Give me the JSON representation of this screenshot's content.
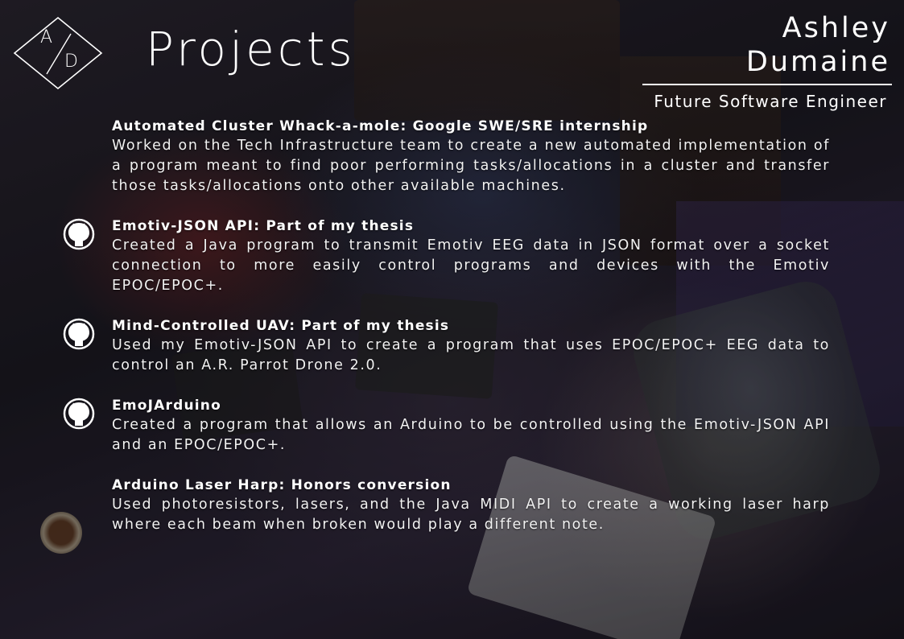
{
  "header": {
    "title": "Projects",
    "monogram": {
      "first": "A",
      "second": "D"
    },
    "name": "Ashley Dumaine",
    "role": "Future Software Engineer"
  },
  "projects": [
    {
      "title": "Automated Cluster Whack-a-mole: Google SWE/SRE internship",
      "description": "Worked on the Tech Infrastructure team to create a new automated implementation of a program meant to find poor performing tasks/allocations in a cluster and transfer those tasks/allocations onto other available machines.",
      "icon": "none"
    },
    {
      "title": "Emotiv-JSON API: Part of my thesis",
      "description": "Created a Java program to transmit Emotiv EEG data in JSON format over a socket connection to more easily control programs and devices with the Emotiv EPOC/EPOC+.",
      "icon": "github-icon"
    },
    {
      "title": "Mind-Controlled UAV: Part of my thesis",
      "description": "Used my Emotiv-JSON API to create a program that uses EPOC/EPOC+ EEG data to control an A.R. Parrot Drone 2.0.",
      "icon": "github-icon"
    },
    {
      "title": "EmoJArduino",
      "description": "Created a program that allows an Arduino to be controlled using the Emotiv-JSON API and an EPOC/EPOC+.",
      "icon": "github-icon"
    },
    {
      "title": "Arduino Laser Harp: Honors conversion",
      "description": "Used photoresistors, lasers, and the Java MIDI API to create a working laser harp where each beam when broken would play a different note.",
      "icon": "none"
    }
  ],
  "colors": {
    "text": "#ffffff",
    "background": "#1a1820"
  }
}
